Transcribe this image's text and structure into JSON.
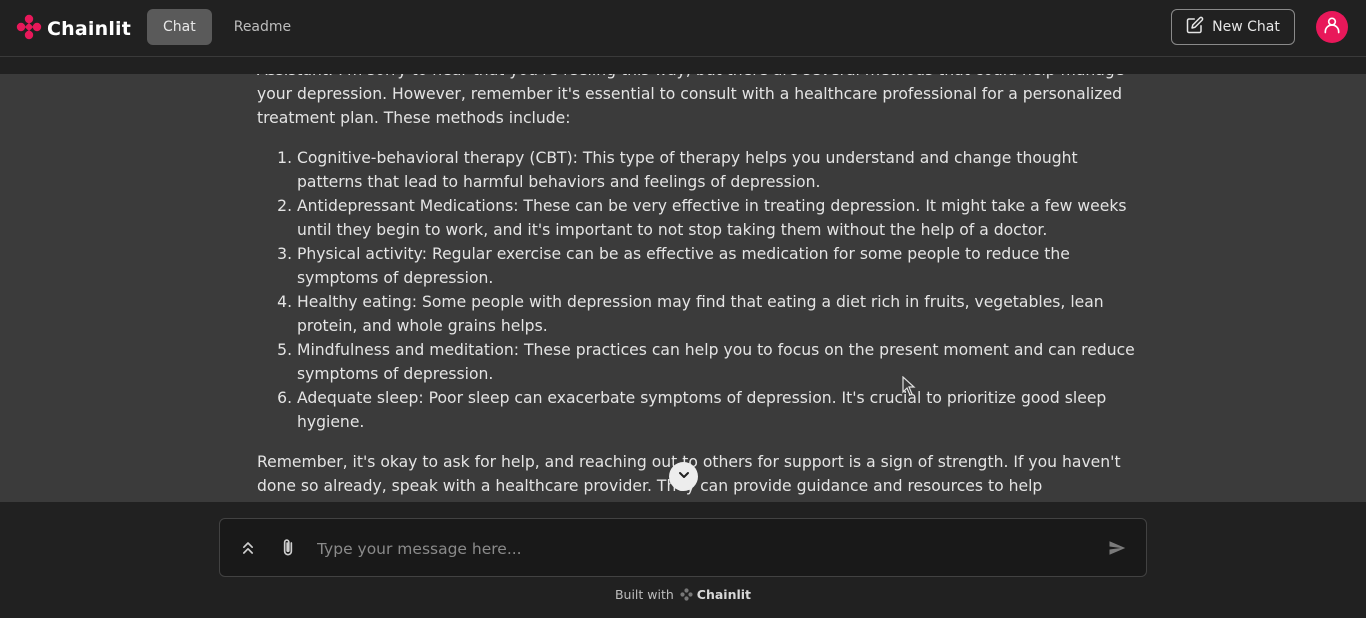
{
  "brand": {
    "name": "Chainlit",
    "accent": "#e8185a"
  },
  "header": {
    "tabs": [
      {
        "label": "Chat",
        "active": true
      },
      {
        "label": "Readme",
        "active": false
      }
    ],
    "new_chat_label": "New Chat",
    "icons": {
      "logo": "chainlit-logo-icon",
      "new_chat": "edit-icon",
      "avatar": "user-icon"
    }
  },
  "message": {
    "intro": "Assistant: I'm sorry to hear that you're feeling this way, but there are several methods that could help manage your depression. However, remember it's essential to consult with a healthcare professional for a personalized treatment plan. These methods include:",
    "items": [
      "Cognitive-behavioral therapy (CBT): This type of therapy helps you understand and change thought patterns that lead to harmful behaviors and feelings of depression.",
      "Antidepressant Medications: These can be very effective in treating depression. It might take a few weeks until they begin to work, and it's important to not stop taking them without the help of a doctor.",
      "Physical activity: Regular exercise can be as effective as medication for some people to reduce the symptoms of depression.",
      "Healthy eating: Some people with depression may find that eating a diet rich in fruits, vegetables, lean protein, and whole grains helps.",
      "Mindfulness and meditation: These practices can help you to focus on the present moment and can reduce symptoms of depression.",
      "Adequate sleep: Poor sleep can exacerbate symptoms of depression. It's crucial to prioritize good sleep hygiene."
    ],
    "outro": "Remember, it's okay to ask for help, and reaching out to others for support is a sign of strength. If you haven't done so already, speak with a healthcare provider. They can provide guidance and resources to help"
  },
  "composer": {
    "placeholder": "Type your message here...",
    "icons": {
      "expand": "chevrons-up-icon",
      "attach": "paperclip-icon",
      "send": "send-icon"
    }
  },
  "footer": {
    "prefix": "Built with",
    "brand": "Chainlit"
  }
}
